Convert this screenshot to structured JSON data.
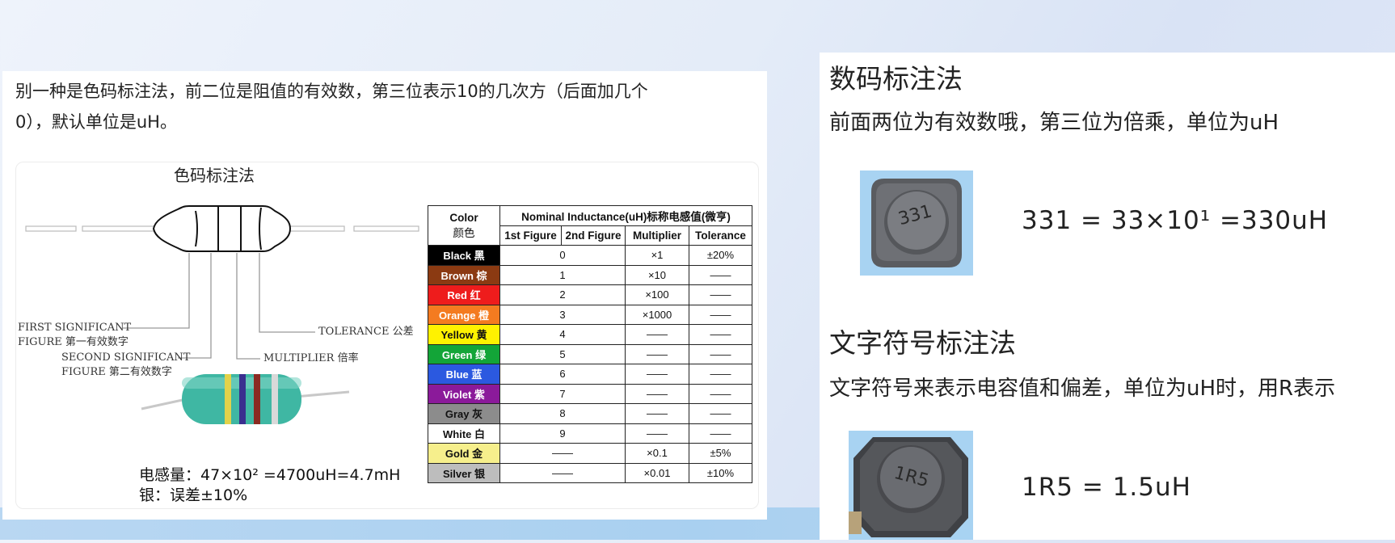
{
  "left": {
    "intro_line1": "别一种是色码标注法，前二位是阻值的有效数，第三位表示10的几次方（后面加几个",
    "intro_line2": "0），默认单位是uH。",
    "figure_title": "色码标注法",
    "labels": {
      "first_sig_1": "FIRST SIGNIFICANT",
      "first_sig_2": "FIGURE 第一有效数字",
      "second_sig_1": "SECOND SIGNIFICANT",
      "second_sig_2": "FIGURE 第二有效数字",
      "tolerance": "TOLERANCE 公差",
      "multiplier": "MULTIPLIER 倍率"
    },
    "caption_line1": "电感量：47×10² =4700uH=4.7mH",
    "caption_line2": "银：误差±10%",
    "band_colors": [
      "#e2d24a",
      "#3a2f8f",
      "#8b2a22",
      "#d9d9d9"
    ],
    "body_color": "#3fb7a3",
    "table": {
      "header_color": "Color",
      "header_color_cn": "颜色",
      "header_nominal": "Nominal Inductance(uH)标称电感值(微亨)",
      "col_first": "1st Figure",
      "col_second": "2nd Figure",
      "col_multiplier": "Multiplier",
      "col_tolerance": "Tolerance",
      "rows": [
        {
          "name": "Black 黑",
          "bg": "#000000",
          "fg": "#ffffff",
          "figure": "0",
          "multiplier": "×1",
          "tolerance": "±20%"
        },
        {
          "name": "Brown 棕",
          "bg": "#8b3a12",
          "fg": "#ffffff",
          "figure": "1",
          "multiplier": "×10",
          "tolerance": "——"
        },
        {
          "name": "Red 红",
          "bg": "#ee1c1c",
          "fg": "#ffffff",
          "figure": "2",
          "multiplier": "×100",
          "tolerance": "——"
        },
        {
          "name": "Orange 橙",
          "bg": "#f47b20",
          "fg": "#ffffff",
          "figure": "3",
          "multiplier": "×1000",
          "tolerance": "——"
        },
        {
          "name": "Yellow 黄",
          "bg": "#fff200",
          "fg": "#111111",
          "figure": "4",
          "multiplier": "——",
          "tolerance": "——"
        },
        {
          "name": "Green 绿",
          "bg": "#13a538",
          "fg": "#ffffff",
          "figure": "5",
          "multiplier": "——",
          "tolerance": "——"
        },
        {
          "name": "Blue 蓝",
          "bg": "#2b59e0",
          "fg": "#ffffff",
          "figure": "6",
          "multiplier": "——",
          "tolerance": "——"
        },
        {
          "name": "Violet 紫",
          "bg": "#8b1a9a",
          "fg": "#ffffff",
          "figure": "7",
          "multiplier": "——",
          "tolerance": "——"
        },
        {
          "name": "Gray 灰",
          "bg": "#8c8c8c",
          "fg": "#111111",
          "figure": "8",
          "multiplier": "——",
          "tolerance": "——"
        },
        {
          "name": "White 白",
          "bg": "#ffffff",
          "fg": "#111111",
          "figure": "9",
          "multiplier": "——",
          "tolerance": "——"
        },
        {
          "name": "Gold 金",
          "bg": "#f6ef8c",
          "fg": "#111111",
          "figure": "——",
          "multiplier": "×0.1",
          "tolerance": "±5%"
        },
        {
          "name": "Silver 银",
          "bg": "#bdbdbd",
          "fg": "#111111",
          "figure": "——",
          "multiplier": "×0.01",
          "tolerance": "±10%"
        }
      ]
    }
  },
  "right": {
    "title1": "数码标注法",
    "text1": "前面两位为有效数哦，第三位为倍乘，单位为uH",
    "chip1_marking": "331",
    "formula1": "331 = 33×10¹ =330uH",
    "title2": "文字符号标注法",
    "text2": "文字符号来表示电容值和偏差，单位为uH时，用R表示",
    "chip2_marking": "1R5",
    "formula2": "1R5 = 1.5uH",
    "chip_bg": "#a8d3f2"
  }
}
